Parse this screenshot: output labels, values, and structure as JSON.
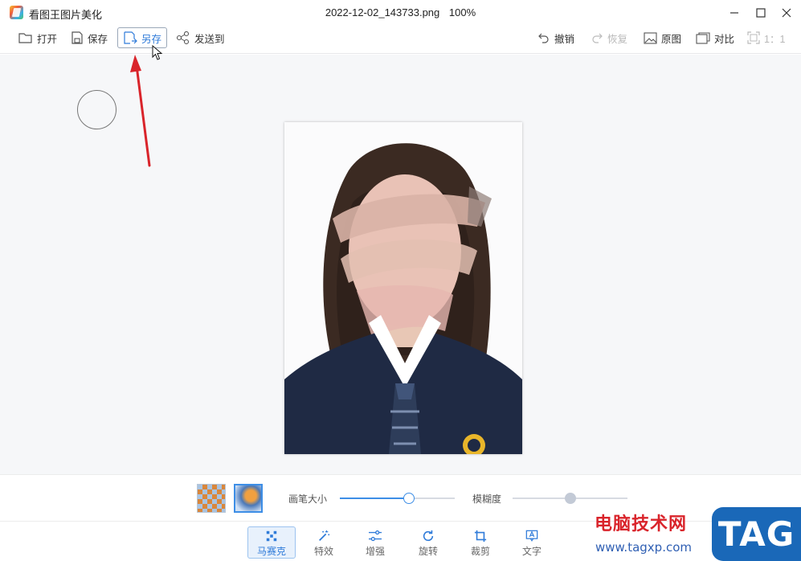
{
  "window": {
    "app_title": "看图王图片美化",
    "file_name": "2022-12-02_143733.png",
    "zoom": "100%"
  },
  "toolbar": {
    "open": "打开",
    "save": "保存",
    "save_as": "另存",
    "send_to": "发送到",
    "undo": "撤销",
    "redo": "恢复",
    "original": "原图",
    "compare": "对比",
    "ratio": "1：1"
  },
  "brush": {
    "size_label": "画笔大小",
    "size_value": 0.6,
    "blur_label": "模糊度",
    "blur_value": 0.5
  },
  "tools": [
    {
      "label": "马赛克",
      "icon": "mosaic-icon",
      "active": true
    },
    {
      "label": "特效",
      "icon": "magic-wand-icon",
      "active": false
    },
    {
      "label": "增强",
      "icon": "sliders-icon",
      "active": false
    },
    {
      "label": "旋转",
      "icon": "rotate-icon",
      "active": false
    },
    {
      "label": "裁剪",
      "icon": "crop-icon",
      "active": false
    },
    {
      "label": "文字",
      "icon": "text-icon",
      "active": false
    }
  ],
  "watermark": {
    "site_name": "电脑技术网",
    "url": "www.tagxp.com",
    "badge": "TAG"
  },
  "colors": {
    "accent": "#2f7bd9",
    "annotation_arrow": "#d9242b",
    "canvas_bg": "#f6f7f9"
  }
}
